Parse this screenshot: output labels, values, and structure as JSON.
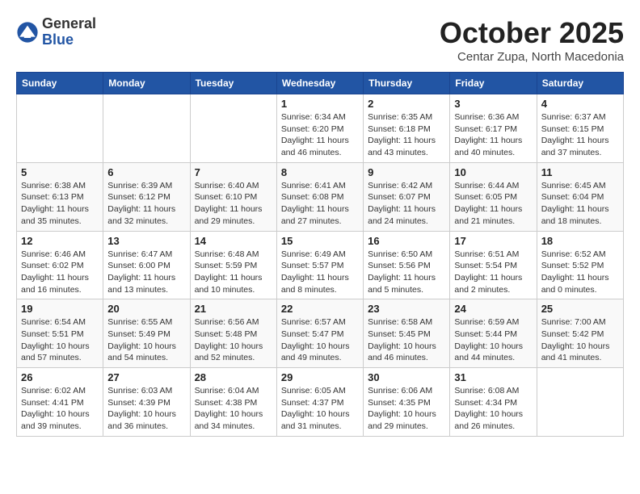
{
  "header": {
    "logo_general": "General",
    "logo_blue": "Blue",
    "month": "October 2025",
    "location": "Centar Zupa, North Macedonia"
  },
  "weekdays": [
    "Sunday",
    "Monday",
    "Tuesday",
    "Wednesday",
    "Thursday",
    "Friday",
    "Saturday"
  ],
  "weeks": [
    [
      {
        "day": "",
        "info": ""
      },
      {
        "day": "",
        "info": ""
      },
      {
        "day": "",
        "info": ""
      },
      {
        "day": "1",
        "info": "Sunrise: 6:34 AM\nSunset: 6:20 PM\nDaylight: 11 hours\nand 46 minutes."
      },
      {
        "day": "2",
        "info": "Sunrise: 6:35 AM\nSunset: 6:18 PM\nDaylight: 11 hours\nand 43 minutes."
      },
      {
        "day": "3",
        "info": "Sunrise: 6:36 AM\nSunset: 6:17 PM\nDaylight: 11 hours\nand 40 minutes."
      },
      {
        "day": "4",
        "info": "Sunrise: 6:37 AM\nSunset: 6:15 PM\nDaylight: 11 hours\nand 37 minutes."
      }
    ],
    [
      {
        "day": "5",
        "info": "Sunrise: 6:38 AM\nSunset: 6:13 PM\nDaylight: 11 hours\nand 35 minutes."
      },
      {
        "day": "6",
        "info": "Sunrise: 6:39 AM\nSunset: 6:12 PM\nDaylight: 11 hours\nand 32 minutes."
      },
      {
        "day": "7",
        "info": "Sunrise: 6:40 AM\nSunset: 6:10 PM\nDaylight: 11 hours\nand 29 minutes."
      },
      {
        "day": "8",
        "info": "Sunrise: 6:41 AM\nSunset: 6:08 PM\nDaylight: 11 hours\nand 27 minutes."
      },
      {
        "day": "9",
        "info": "Sunrise: 6:42 AM\nSunset: 6:07 PM\nDaylight: 11 hours\nand 24 minutes."
      },
      {
        "day": "10",
        "info": "Sunrise: 6:44 AM\nSunset: 6:05 PM\nDaylight: 11 hours\nand 21 minutes."
      },
      {
        "day": "11",
        "info": "Sunrise: 6:45 AM\nSunset: 6:04 PM\nDaylight: 11 hours\nand 18 minutes."
      }
    ],
    [
      {
        "day": "12",
        "info": "Sunrise: 6:46 AM\nSunset: 6:02 PM\nDaylight: 11 hours\nand 16 minutes."
      },
      {
        "day": "13",
        "info": "Sunrise: 6:47 AM\nSunset: 6:00 PM\nDaylight: 11 hours\nand 13 minutes."
      },
      {
        "day": "14",
        "info": "Sunrise: 6:48 AM\nSunset: 5:59 PM\nDaylight: 11 hours\nand 10 minutes."
      },
      {
        "day": "15",
        "info": "Sunrise: 6:49 AM\nSunset: 5:57 PM\nDaylight: 11 hours\nand 8 minutes."
      },
      {
        "day": "16",
        "info": "Sunrise: 6:50 AM\nSunset: 5:56 PM\nDaylight: 11 hours\nand 5 minutes."
      },
      {
        "day": "17",
        "info": "Sunrise: 6:51 AM\nSunset: 5:54 PM\nDaylight: 11 hours\nand 2 minutes."
      },
      {
        "day": "18",
        "info": "Sunrise: 6:52 AM\nSunset: 5:52 PM\nDaylight: 11 hours\nand 0 minutes."
      }
    ],
    [
      {
        "day": "19",
        "info": "Sunrise: 6:54 AM\nSunset: 5:51 PM\nDaylight: 10 hours\nand 57 minutes."
      },
      {
        "day": "20",
        "info": "Sunrise: 6:55 AM\nSunset: 5:49 PM\nDaylight: 10 hours\nand 54 minutes."
      },
      {
        "day": "21",
        "info": "Sunrise: 6:56 AM\nSunset: 5:48 PM\nDaylight: 10 hours\nand 52 minutes."
      },
      {
        "day": "22",
        "info": "Sunrise: 6:57 AM\nSunset: 5:47 PM\nDaylight: 10 hours\nand 49 minutes."
      },
      {
        "day": "23",
        "info": "Sunrise: 6:58 AM\nSunset: 5:45 PM\nDaylight: 10 hours\nand 46 minutes."
      },
      {
        "day": "24",
        "info": "Sunrise: 6:59 AM\nSunset: 5:44 PM\nDaylight: 10 hours\nand 44 minutes."
      },
      {
        "day": "25",
        "info": "Sunrise: 7:00 AM\nSunset: 5:42 PM\nDaylight: 10 hours\nand 41 minutes."
      }
    ],
    [
      {
        "day": "26",
        "info": "Sunrise: 6:02 AM\nSunset: 4:41 PM\nDaylight: 10 hours\nand 39 minutes."
      },
      {
        "day": "27",
        "info": "Sunrise: 6:03 AM\nSunset: 4:39 PM\nDaylight: 10 hours\nand 36 minutes."
      },
      {
        "day": "28",
        "info": "Sunrise: 6:04 AM\nSunset: 4:38 PM\nDaylight: 10 hours\nand 34 minutes."
      },
      {
        "day": "29",
        "info": "Sunrise: 6:05 AM\nSunset: 4:37 PM\nDaylight: 10 hours\nand 31 minutes."
      },
      {
        "day": "30",
        "info": "Sunrise: 6:06 AM\nSunset: 4:35 PM\nDaylight: 10 hours\nand 29 minutes."
      },
      {
        "day": "31",
        "info": "Sunrise: 6:08 AM\nSunset: 4:34 PM\nDaylight: 10 hours\nand 26 minutes."
      },
      {
        "day": "",
        "info": ""
      }
    ]
  ]
}
